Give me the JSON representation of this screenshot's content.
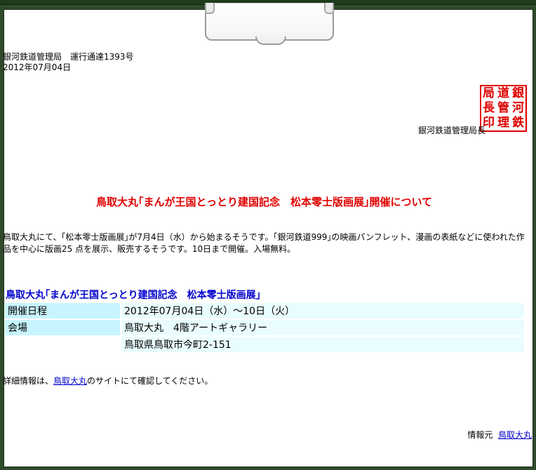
{
  "header": {
    "org_line": "銀河鉄道管理局　運行通達1393号",
    "date": "2012年07月04日"
  },
  "stamp": {
    "chars": [
      "局",
      "道",
      "銀",
      "長",
      "管",
      "河",
      "印",
      "理",
      "鉄"
    ]
  },
  "director": "銀河鉄道管理局長",
  "title": "鳥取大丸｢まんが王国とっとり建国記念　松本零士版画展｣開催について",
  "body": "鳥取大丸にて、｢松本零士版画展｣が7月4日（水）から始まるそうです。｢銀河鉄道999｣の映画パンフレット、漫画の表紙などに使われた作品を中心に版画25 点を展示、販売するそうです。10日まで開催。入場無料。",
  "event": {
    "title": "鳥取大丸｢まんが王国とっとり建国記念　松本零士版画展｣",
    "rows": [
      {
        "label": "開催日程",
        "value": "2012年07月04日（水）～10日（火）"
      },
      {
        "label": "会場",
        "value": "鳥取大丸　4階アートギャラリー"
      },
      {
        "label": "",
        "value": "鳥取県鳥取市今町2-151"
      }
    ]
  },
  "detail": {
    "prefix": "詳細情報は、",
    "link": "鳥取大丸",
    "suffix": "のサイトにて確認してください。"
  },
  "source": {
    "label": "情報元",
    "link": "鳥取大丸"
  }
}
